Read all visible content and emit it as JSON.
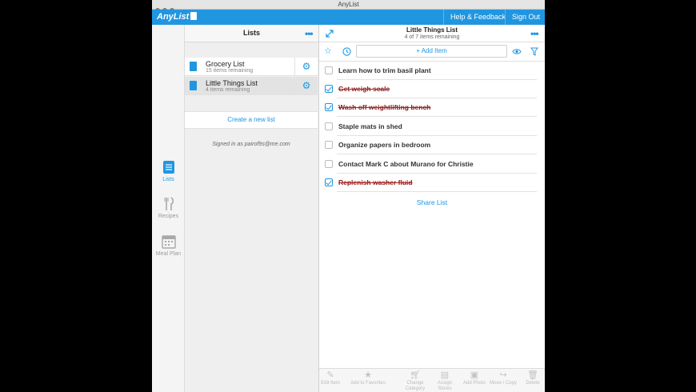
{
  "window": {
    "title": "AnyList"
  },
  "app": {
    "logo": "AnyList",
    "help_label": "Help & Feedback",
    "signout_label": "Sign Out",
    "accent_color": "#2196e0"
  },
  "nav": {
    "items": [
      {
        "label": "Lists",
        "icon": "lists-icon"
      },
      {
        "label": "Recipes",
        "icon": "recipes-icon"
      },
      {
        "label": "Meal Plan",
        "icon": "calendar-icon"
      }
    ]
  },
  "lists_pane": {
    "title": "Lists",
    "lists": [
      {
        "name": "Grocery List",
        "subtitle": "15 items remaining"
      },
      {
        "name": "Little Things List",
        "subtitle": "4 items remaining"
      }
    ],
    "create_label": "Create a new list",
    "signed_in": "Signed in as pairof9s@me.com"
  },
  "main": {
    "title": "Little Things List",
    "subtitle": "4 of 7 items remaining",
    "add_item": "+ Add Item",
    "items": [
      {
        "text": "Learn how to trim basil plant",
        "checked": false
      },
      {
        "text": "Get weigh scale",
        "checked": true
      },
      {
        "text": "Wash off weightlifting bench",
        "checked": true
      },
      {
        "text": "Staple mats in shed",
        "checked": false
      },
      {
        "text": "Organize papers in bedroom",
        "checked": false
      },
      {
        "text": "Contact Mark C about Murano for Christie",
        "checked": false
      },
      {
        "text": "Replenish washer fluid",
        "checked": true
      }
    ],
    "share_label": "Share List"
  },
  "bottom_toolbar": [
    {
      "label": "Edit Item",
      "icon": "pencil-icon"
    },
    {
      "label": "Add to Favorites",
      "icon": "star-icon"
    },
    {
      "label": "Change Category",
      "icon": "cart-icon"
    },
    {
      "label": "Assign Stores",
      "icon": "store-icon"
    },
    {
      "label": "Add Photo",
      "icon": "photo-icon"
    },
    {
      "label": "Move / Copy",
      "icon": "move-icon"
    },
    {
      "label": "Delete",
      "icon": "trash-icon"
    }
  ]
}
